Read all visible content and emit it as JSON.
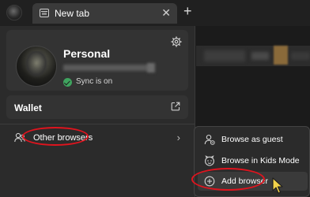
{
  "tab": {
    "title": "New tab",
    "close_glyph": "✕"
  },
  "newtab_glyph": "+",
  "profile": {
    "name": "Personal",
    "sync_status": "Sync is on"
  },
  "wallet": {
    "label": "Wallet"
  },
  "other_browsers": {
    "label": "Other browsers",
    "chevron_glyph": "›"
  },
  "submenu": {
    "items": [
      {
        "label": "Browse as guest",
        "icon": "guest-icon"
      },
      {
        "label": "Browse in Kids Mode",
        "icon": "kids-mode-icon"
      },
      {
        "label": "Add browser",
        "icon": "add-icon"
      }
    ]
  },
  "colors": {
    "annotation_red": "#e0141e",
    "sync_green": "#3fa45f",
    "panel": "#2b2b2b",
    "card": "#333333"
  }
}
